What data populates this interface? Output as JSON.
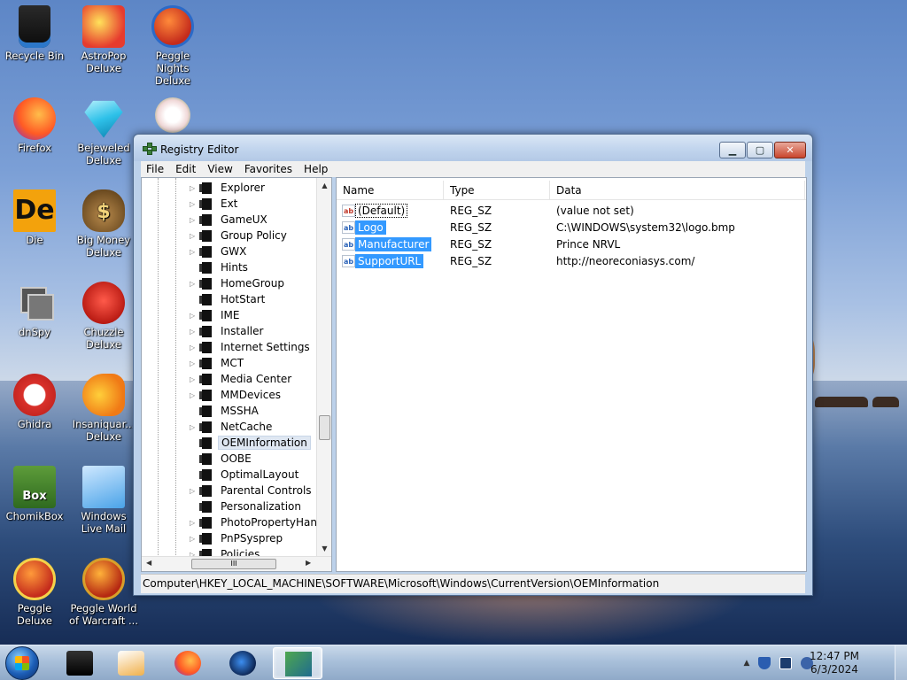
{
  "desktop": {
    "icons": [
      {
        "label": "Recycle Bin",
        "icon": "recycle-bin-icon"
      },
      {
        "label": "AstroPop Deluxe",
        "icon": "astropop-icon"
      },
      {
        "label": "Peggle Nights Deluxe",
        "icon": "peggle-nights-icon"
      },
      {
        "label": "Firefox",
        "icon": "firefox-icon"
      },
      {
        "label": "Bejeweled Deluxe",
        "icon": "bejeweled-icon"
      },
      {
        "label": "",
        "icon": "flower-game-icon"
      },
      {
        "label": "Die",
        "icon": "die-icon"
      },
      {
        "label": "Big Money Deluxe",
        "icon": "big-money-icon"
      },
      {
        "label": "dnSpy",
        "icon": "dnspy-icon"
      },
      {
        "label": "Chuzzle Deluxe",
        "icon": "chuzzle-icon"
      },
      {
        "label": "Ghidra",
        "icon": "ghidra-icon"
      },
      {
        "label": "Insaniquar... Deluxe",
        "icon": "insaniquarium-icon"
      },
      {
        "label": "ChomikBox",
        "icon": "chomikbox-icon"
      },
      {
        "label": "Windows Live Mail",
        "icon": "windows-live-mail-icon"
      },
      {
        "label": "Peggle Deluxe",
        "icon": "peggle-deluxe-icon"
      },
      {
        "label": "Peggle World of Warcraft ...",
        "icon": "peggle-wow-icon"
      }
    ],
    "die_glyph": "De",
    "money_glyph": "$",
    "chomik_glyph": "Box"
  },
  "window": {
    "title": "Registry Editor",
    "controls": {
      "minimize": "▁",
      "maximize": "▢",
      "close": "✕"
    },
    "menu": [
      "File",
      "Edit",
      "View",
      "Favorites",
      "Help"
    ],
    "tree": {
      "items": [
        {
          "label": "Explorer",
          "expandable": true
        },
        {
          "label": "Ext",
          "expandable": true
        },
        {
          "label": "GameUX",
          "expandable": true
        },
        {
          "label": "Group Policy",
          "expandable": true
        },
        {
          "label": "GWX",
          "expandable": true
        },
        {
          "label": "Hints",
          "expandable": false
        },
        {
          "label": "HomeGroup",
          "expandable": true
        },
        {
          "label": "HotStart",
          "expandable": false
        },
        {
          "label": "IME",
          "expandable": true
        },
        {
          "label": "Installer",
          "expandable": true
        },
        {
          "label": "Internet Settings",
          "expandable": true
        },
        {
          "label": "MCT",
          "expandable": true
        },
        {
          "label": "Media Center",
          "expandable": true
        },
        {
          "label": "MMDevices",
          "expandable": true
        },
        {
          "label": "MSSHA",
          "expandable": false
        },
        {
          "label": "NetCache",
          "expandable": true
        },
        {
          "label": "OEMInformation",
          "expandable": false,
          "selected": true
        },
        {
          "label": "OOBE",
          "expandable": false
        },
        {
          "label": "OptimalLayout",
          "expandable": false
        },
        {
          "label": "Parental Controls",
          "expandable": true
        },
        {
          "label": "Personalization",
          "expandable": false
        },
        {
          "label": "PhotoPropertyHandl",
          "expandable": true
        },
        {
          "label": "PnPSysprep",
          "expandable": true
        },
        {
          "label": "Policies",
          "expandable": true
        }
      ],
      "hscroll_thumb": "III"
    },
    "list": {
      "columns": [
        "Name",
        "Type",
        "Data"
      ],
      "rows": [
        {
          "name": "(Default)",
          "type": "REG_SZ",
          "data": "(value not set)",
          "icon": "string-value-icon",
          "highlight": false,
          "focus": true
        },
        {
          "name": "Logo",
          "type": "REG_SZ",
          "data": "C:\\WINDOWS\\system32\\logo.bmp",
          "icon": "string-value-icon",
          "highlight": true
        },
        {
          "name": "Manufacturer",
          "type": "REG_SZ",
          "data": "Prince NRVL",
          "icon": "string-value-icon",
          "highlight": true
        },
        {
          "name": "SupportURL",
          "type": "REG_SZ",
          "data": "http://neoreconiasys.com/",
          "icon": "string-value-icon",
          "highlight": true
        }
      ],
      "value_icon_glyph": "ab"
    },
    "status_path": "Computer\\HKEY_LOCAL_MACHINE\\SOFTWARE\\Microsoft\\Windows\\CurrentVersion\\OEMInformation"
  },
  "taskbar": {
    "items": [
      {
        "icon": "black-box-icon"
      },
      {
        "icon": "media-player-icon"
      },
      {
        "icon": "firefox-icon"
      },
      {
        "icon": "globe-icon"
      },
      {
        "icon": "registry-editor-icon",
        "active": true
      }
    ],
    "tray": {
      "show_hidden": "▲",
      "time": "12:47 PM",
      "date": "6/3/2024"
    }
  }
}
